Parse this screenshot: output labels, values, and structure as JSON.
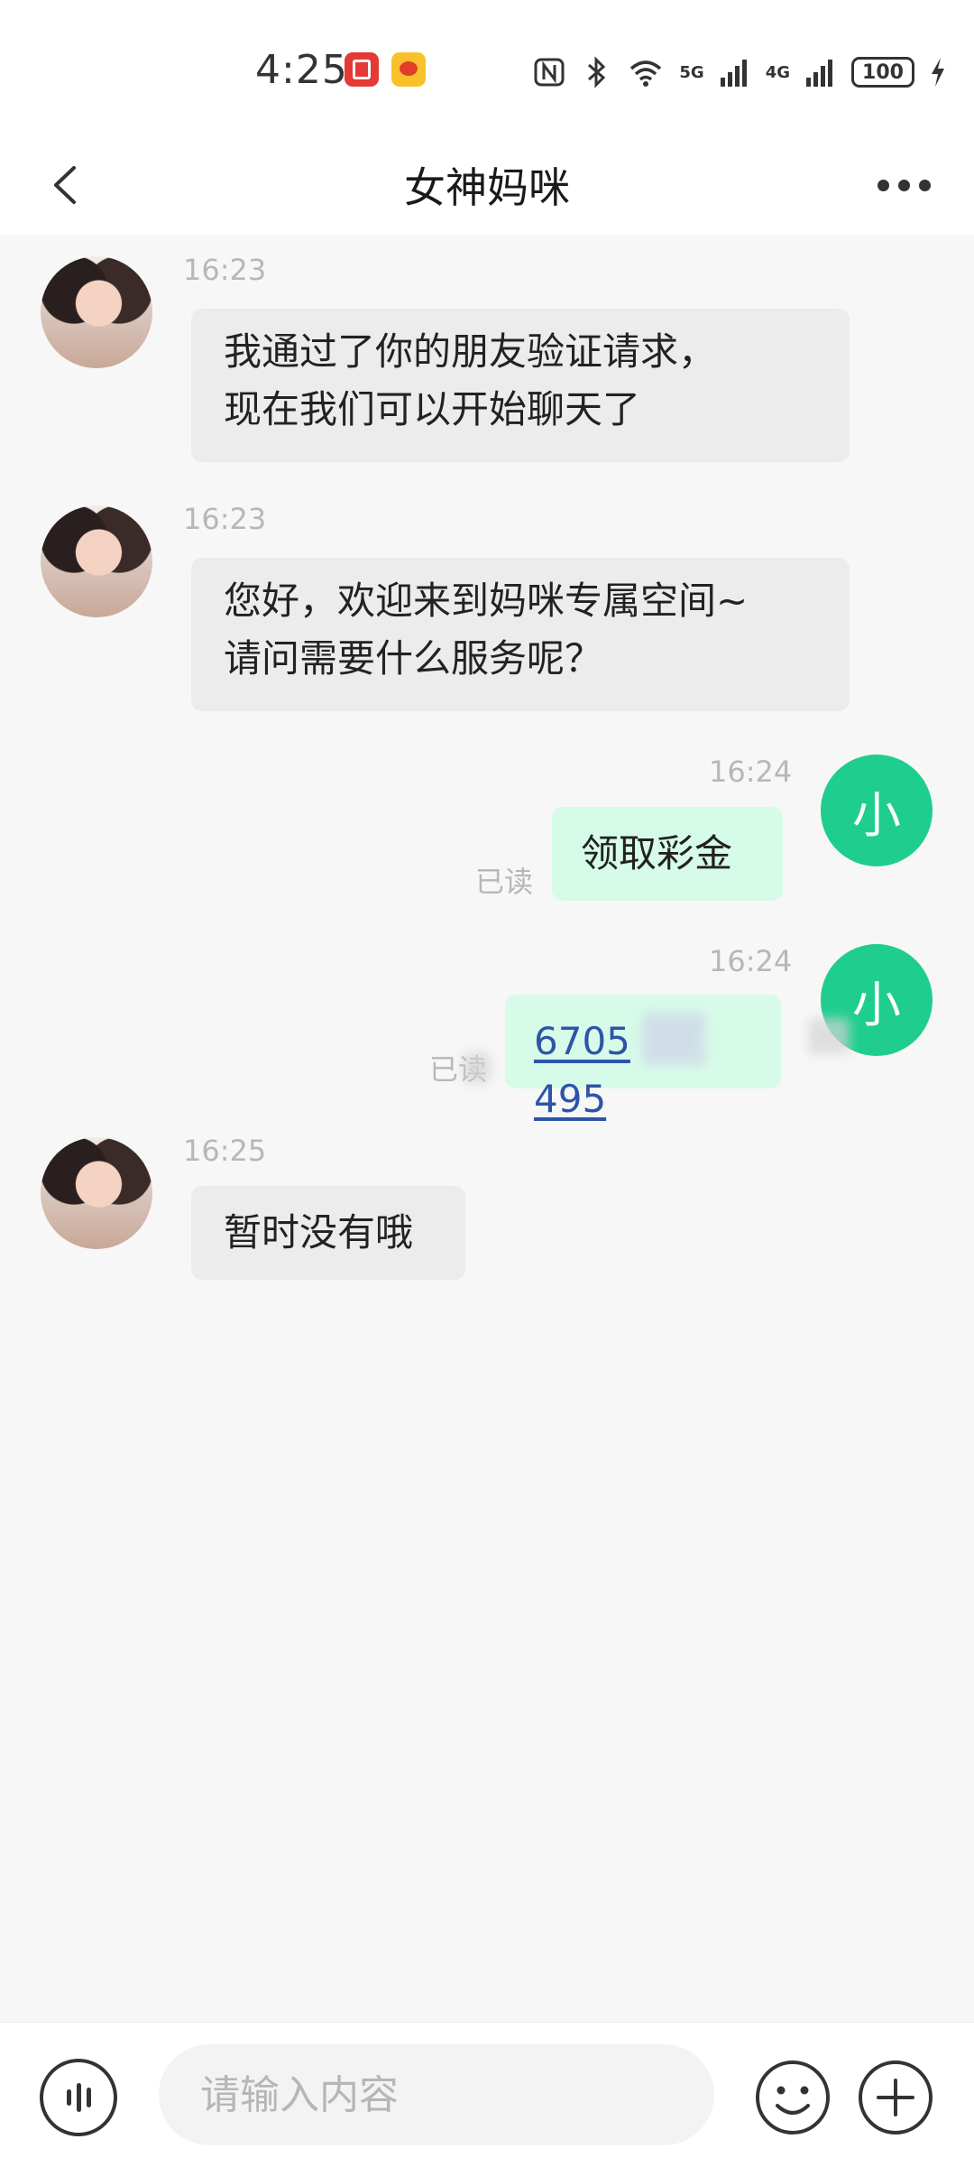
{
  "status": {
    "time": "4:25",
    "signal1": "5G",
    "signal2": "4G",
    "battery": "100"
  },
  "header": {
    "title": "女神妈咪"
  },
  "messages": [
    {
      "time": "16:23",
      "text_lines": [
        "我通过了你的朋友验证请求，",
        "现在我们可以开始聊天了"
      ]
    },
    {
      "time": "16:23",
      "text_lines": [
        "您好，欢迎来到妈咪专属空间~",
        "请问需要什么服务呢？"
      ]
    },
    {
      "time": "16:24",
      "text": "领取彩金",
      "avatar": "小",
      "read": "已读"
    },
    {
      "time": "16:24",
      "text": "6705",
      "text2": "495",
      "avatar": "小",
      "read": "已读"
    },
    {
      "time": "16:25",
      "text": "暂时没有哦"
    }
  ],
  "input": {
    "placeholder": "请输入内容"
  },
  "colors": {
    "accent": "#1fcd8f",
    "out_bubble": "#d7fbe9",
    "in_bubble": "#ececec",
    "link": "#2c55a8"
  },
  "icons": [
    "back-arrow-icon",
    "more-icon",
    "voice-icon",
    "emoji-icon",
    "plus-icon",
    "nfc-icon",
    "bluetooth-icon",
    "wifi-icon",
    "signal-icon",
    "battery-icon",
    "charging-icon"
  ]
}
